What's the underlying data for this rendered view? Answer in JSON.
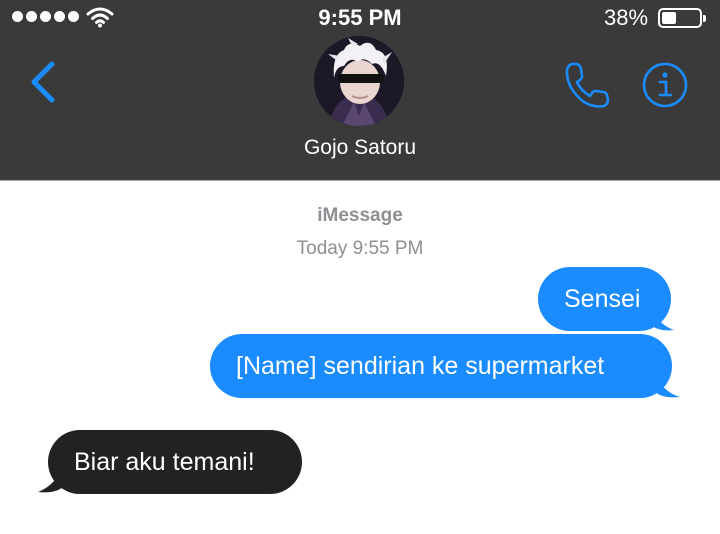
{
  "status_bar": {
    "time": "9:55 PM",
    "battery_percent_text": "38%",
    "battery_level": 0.38,
    "signal_bars": 5,
    "icons": [
      "signal-dots-icon",
      "wifi-icon",
      "battery-icon"
    ]
  },
  "header": {
    "contact_name": "Gojo Satoru",
    "back_icon": "chevron-left-icon",
    "call_icon": "phone-icon",
    "info_icon": "info-icon",
    "accent_color": "#1a8cff",
    "background_color": "#3a3a3a"
  },
  "conversation": {
    "service": "iMessage",
    "timestamp": "Today 9:55 PM",
    "messages": [
      {
        "direction": "outgoing",
        "text": "Sensei"
      },
      {
        "direction": "outgoing",
        "text": "[Name] sendirian ke supermarket"
      },
      {
        "direction": "incoming",
        "text": "Biar aku temani!"
      }
    ],
    "outgoing_color": "#1a8cff",
    "incoming_color": "#222222"
  }
}
